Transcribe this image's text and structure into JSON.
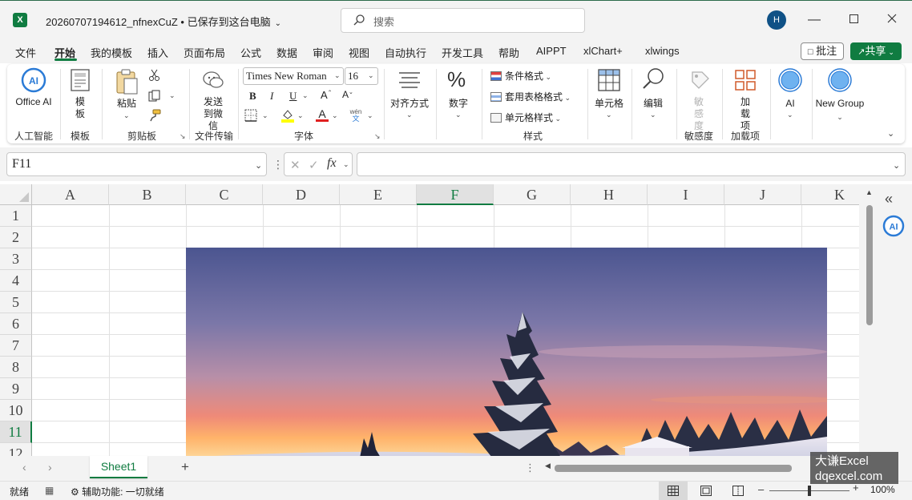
{
  "title_bar": {
    "doc_title": "20260707194612_nfnexCuZ • 已保存到这台电脑",
    "search_placeholder": "搜索",
    "avatar_initial": "H",
    "app_logo": "X"
  },
  "menu": {
    "tabs": [
      "文件",
      "开始",
      "我的模板",
      "插入",
      "页面布局",
      "公式",
      "数据",
      "审阅",
      "视图",
      "自动执行",
      "开发工具",
      "帮助",
      "AIPPT",
      "xlChart+",
      "xlwings"
    ],
    "active_tab": "开始",
    "comments": "批注",
    "share": "共享"
  },
  "ribbon": {
    "ai": {
      "button": "Office AI",
      "group": "人工智能"
    },
    "template": {
      "button": "模板",
      "group": "模板"
    },
    "clipboard": {
      "paste": "粘贴",
      "group": "剪贴板"
    },
    "file_transfer": {
      "button": "发送到微信",
      "group": "文件传输"
    },
    "font": {
      "name": "Times New Roman",
      "size": "16",
      "bold": "B",
      "italic": "I",
      "underline": "U",
      "font_color": "A",
      "grow": "A",
      "shrink": "A",
      "phonetic_top": "wén",
      "phonetic_bottom": "文",
      "group": "字体"
    },
    "alignment": {
      "button": "对齐方式"
    },
    "number": {
      "button": "数字"
    },
    "styles": {
      "conditional": "条件格式",
      "table_format": "套用表格格式",
      "cell_styles": "单元格样式",
      "group": "样式"
    },
    "cells": {
      "button": "单元格"
    },
    "editing": {
      "button": "编辑"
    },
    "sensitivity": {
      "button": "敏感度",
      "group": "敏感度"
    },
    "addins": {
      "button": "加载项",
      "group": "加载项"
    },
    "ai2": {
      "button": "AI"
    },
    "new_group": {
      "button": "New Group"
    }
  },
  "formula_bar": {
    "name_box": "F11",
    "fx": "fx"
  },
  "grid": {
    "columns": [
      "A",
      "B",
      "C",
      "D",
      "E",
      "F",
      "G",
      "H",
      "I",
      "J",
      "K"
    ],
    "rows": [
      "1",
      "2",
      "3",
      "4",
      "5",
      "6",
      "7",
      "8",
      "9",
      "10",
      "11",
      "12"
    ],
    "selected_column": "F",
    "selected_row": "11"
  },
  "sheets": {
    "tabs": [
      "Sheet1"
    ],
    "add": "+"
  },
  "status": {
    "ready": "就绪",
    "accessibility": "辅助功能: 一切就绪",
    "zoom": "100%"
  },
  "watermark": {
    "line1": "大谦Excel",
    "line2": "dqexcel.com"
  },
  "colors": {
    "accent": "#107c41",
    "avatar": "#0f5186"
  }
}
